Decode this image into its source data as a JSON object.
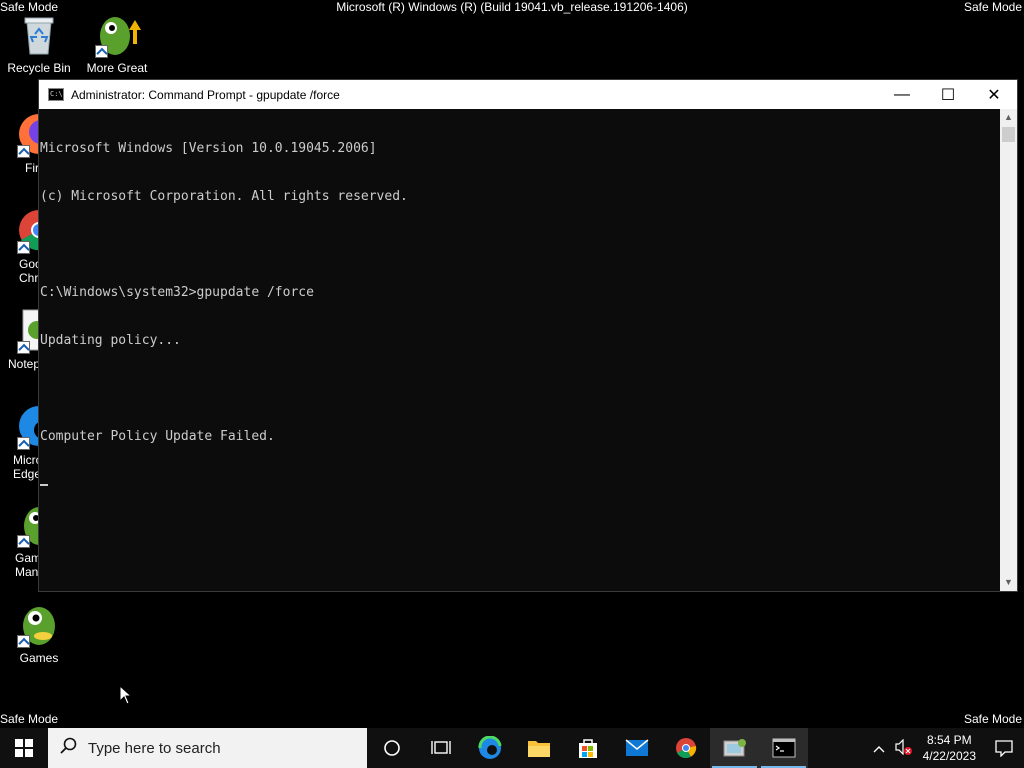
{
  "watermark": {
    "safe_mode": "Safe Mode",
    "build": "Microsoft (R) Windows (R) (Build 19041.vb_release.191206-1406)"
  },
  "desktop_icons": [
    {
      "label": "Recycle Bin",
      "icon": "recycle-bin-icon"
    },
    {
      "label": "More Great Games",
      "icon": "more-games-icon"
    },
    {
      "label": "Firefox",
      "icon": "firefox-icon"
    },
    {
      "label": "Google Chrome",
      "icon": "chrome-icon"
    },
    {
      "label": "Notepad",
      "icon": "notepad-icon"
    },
    {
      "label": "Microsoft Edge",
      "icon": "edge-icon"
    },
    {
      "label": "Game Manager",
      "icon": "game-manager-icon"
    },
    {
      "label": "Games",
      "icon": "games-icon"
    }
  ],
  "cmd": {
    "title": "Administrator:  Command Prompt - gpupdate  /force",
    "lines": [
      "Microsoft Windows [Version 10.0.19045.2006]",
      "(c) Microsoft Corporation. All rights reserved.",
      "",
      "C:\\Windows\\system32>gpupdate /force",
      "Updating policy...",
      "",
      "Computer Policy Update Failed."
    ],
    "minimize": "—",
    "maximize": "☐",
    "close": "✕"
  },
  "taskbar": {
    "search_placeholder": "Type here to search",
    "apps": [
      "cortana-icon",
      "task-view-icon",
      "edge-icon",
      "file-explorer-icon",
      "store-icon",
      "mail-icon",
      "chrome-icon",
      "system-tool-icon",
      "command-prompt-icon"
    ],
    "time": "8:54 PM",
    "date": "4/22/2023"
  }
}
